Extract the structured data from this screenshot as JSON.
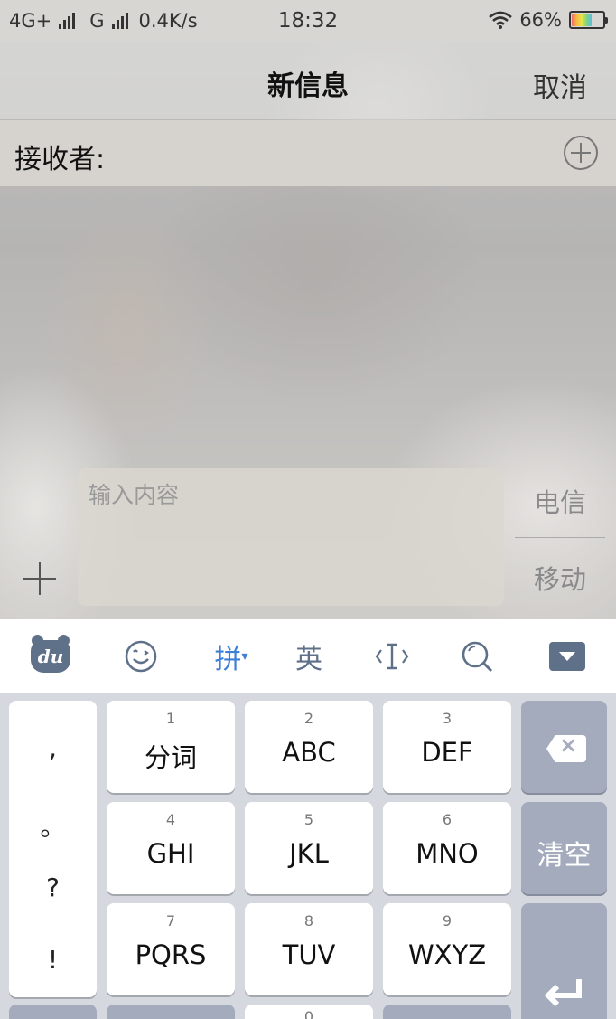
{
  "status_bar": {
    "network1": "4G+",
    "network2": "G",
    "speed": "0.4K/s",
    "time": "18:32",
    "battery": "66%",
    "battery_level": 0.66
  },
  "nav": {
    "title": "新信息",
    "cancel": "取消"
  },
  "recipient": {
    "label": "接收者:"
  },
  "compose": {
    "placeholder": "输入内容",
    "sim_options": [
      "电信",
      "移动"
    ]
  },
  "keyboard_toolbar": {
    "logo": "du",
    "icons": [
      "baidu-logo-icon",
      "emoji-icon",
      "cursor-icon",
      "search-icon",
      "collapse-keyboard-icon"
    ],
    "pinyin": "拼",
    "english": "英"
  },
  "keyboard": {
    "punctuation": [
      ",",
      "。",
      "?",
      "!"
    ],
    "keys": [
      {
        "num": "1",
        "label": "分词"
      },
      {
        "num": "2",
        "label": "ABC"
      },
      {
        "num": "3",
        "label": "DEF"
      },
      {
        "num": "4",
        "label": "GHI"
      },
      {
        "num": "5",
        "label": "JKL"
      },
      {
        "num": "6",
        "label": "MNO"
      },
      {
        "num": "7",
        "label": "PQRS"
      },
      {
        "num": "8",
        "label": "TUV"
      },
      {
        "num": "9",
        "label": "WXYZ"
      },
      {
        "num": "0",
        "label": ""
      }
    ],
    "clear": "清空"
  },
  "colors": {
    "accent": "#3d7fd6",
    "function_key": "#a3abbd",
    "icon": "#5f7189"
  }
}
